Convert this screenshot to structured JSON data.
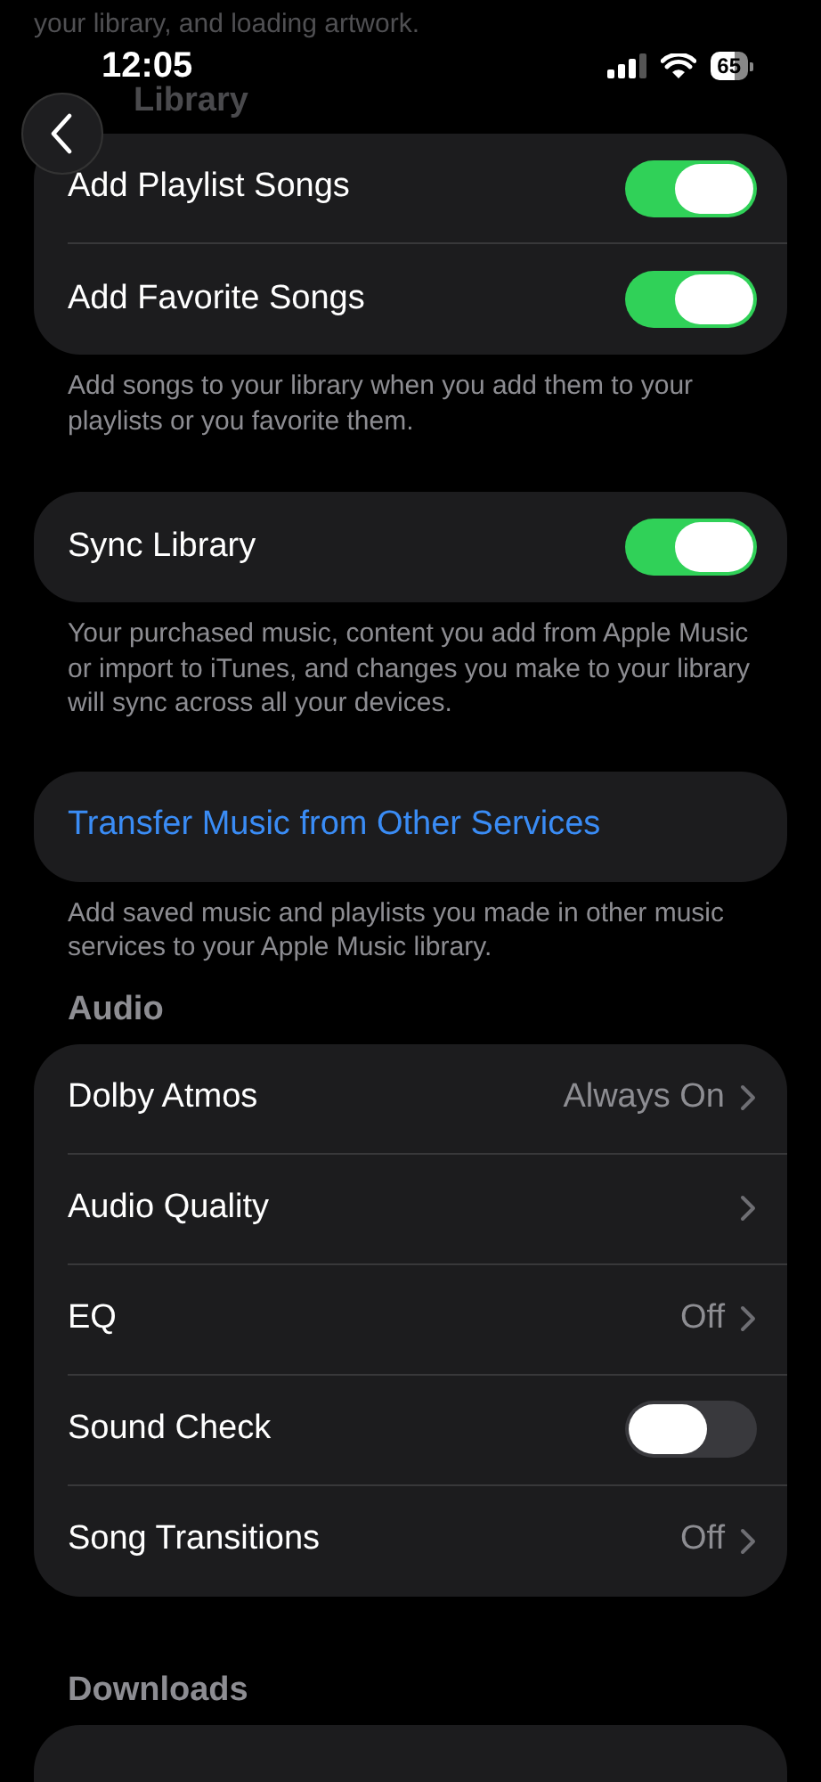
{
  "top_note": "your library, and loading artwork.",
  "status_bar": {
    "time": "12:05",
    "battery": "65"
  },
  "sections": [
    {
      "header": {
        "text": "Library",
        "dimmed": true
      },
      "rows": [
        {
          "kind": "toggle",
          "label": "Add Playlist Songs",
          "on": true
        },
        {
          "kind": "toggle",
          "label": "Add Favorite Songs",
          "on": true
        }
      ],
      "footer": "Add songs to your library when you add them to your playlists or you favorite them."
    },
    {
      "rows": [
        {
          "kind": "toggle",
          "label": "Sync Library",
          "on": true
        }
      ],
      "footer": "Your purchased music, content you add from Apple Music or import to iTunes, and changes you make to your library will sync across all your devices."
    },
    {
      "rows": [
        {
          "kind": "action",
          "label": "Transfer Music from Other Services"
        }
      ],
      "footer": "Add saved music and playlists you made in other music services to your Apple Music library."
    },
    {
      "header": {
        "text": "Audio"
      },
      "rows": [
        {
          "kind": "detail",
          "label": "Dolby Atmos",
          "value": "Always On"
        },
        {
          "kind": "detail",
          "label": "Audio Quality"
        },
        {
          "kind": "detail",
          "label": "EQ",
          "value": "Off"
        },
        {
          "kind": "toggle",
          "label": "Sound Check",
          "on": false
        },
        {
          "kind": "detail",
          "label": "Song Transitions",
          "value": "Off"
        }
      ]
    },
    {
      "header": {
        "text": "Downloads"
      }
    }
  ]
}
